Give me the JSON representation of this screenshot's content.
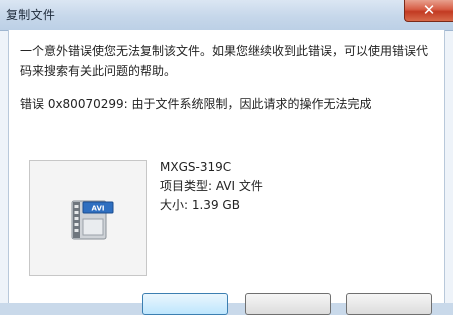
{
  "window": {
    "title": "复制文件",
    "close_label": "✕"
  },
  "message": {
    "text": "一个意外错误使您无法复制该文件。如果您继续收到此错误，可以使用错误代码来搜索有关此问题的帮助。",
    "error": "错误 0x80070299: 由于文件系统限制，因此请求的操作无法完成"
  },
  "file": {
    "name": "MXGS-319C",
    "type_line": "项目类型: AVI 文件",
    "size_line": "大小: 1.39 GB",
    "icon": "avi-video-file-icon",
    "icon_badge": "AVI"
  },
  "colors": {
    "titlebar": "#c6d7ea",
    "close": "#c23a22",
    "badge": "#2f6fc0"
  }
}
